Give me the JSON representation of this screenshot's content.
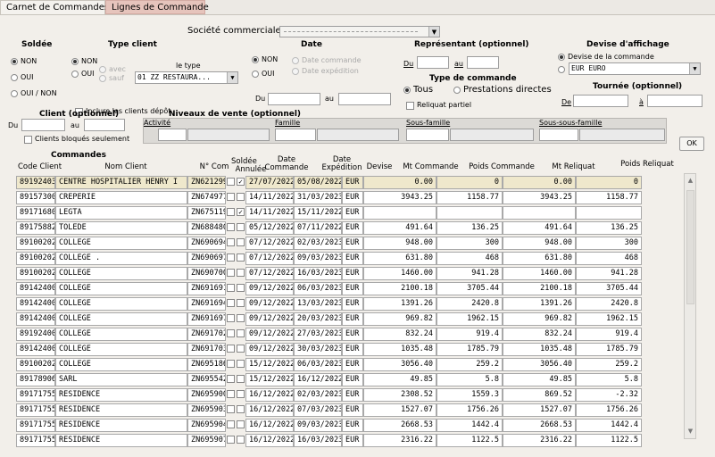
{
  "tabs": [
    {
      "label": "Carnet de Commandes",
      "active": true
    },
    {
      "label": "Lignes de Commande",
      "active": false
    }
  ],
  "filters": {
    "societe_label": "Société commerciale :",
    "societe_value": "",
    "soldee": {
      "title": "Soldée",
      "options": [
        "NON",
        "OUI",
        "OUI / NON"
      ],
      "selected": "NON"
    },
    "type_client": {
      "title": "Type client",
      "options": [
        "NON",
        "OUI"
      ],
      "selected": "NON",
      "sub_options": [
        "avec",
        "sauf"
      ],
      "le_type_label": "le type",
      "le_type_value": "01 ZZ RESTAURA...",
      "inclure_label": "Inclure les clients dépôt"
    },
    "date": {
      "title": "Date",
      "options": [
        "NON",
        "OUI"
      ],
      "selected": "NON",
      "sub_options": [
        "Date commande",
        "Date expédition"
      ],
      "du_label": "Du",
      "au_label": "au"
    },
    "representant": {
      "title": "Représentant (optionnel)",
      "du_label": "Du",
      "au_label": "au"
    },
    "type_commande": {
      "title": "Type de commande",
      "options": [
        "Tous",
        "Prestations directes"
      ],
      "selected": "Tous",
      "reliquat_label": "Reliquat partiel"
    },
    "devise": {
      "title": "Devise d'affichage",
      "options": [
        "Devise de la commande",
        "EUR  EURO"
      ],
      "selected": "Devise de la commande",
      "select_value": "EUR  EURO"
    },
    "tournee": {
      "title": "Tournée (optionnel)",
      "de_label": "De",
      "a_label": "à"
    },
    "client": {
      "title": "Client (optionnel)",
      "du_label": "Du",
      "au_label": "au",
      "bloques_label": "Clients bloqués seulement"
    },
    "niveaux": {
      "title": "Niveaux de vente (optionnel)",
      "labels": [
        "Activité",
        "Famille",
        "Sous-famille",
        "Sous-sous-famille"
      ]
    },
    "ok_label": "OK"
  },
  "commandes": {
    "title": "Commandes",
    "headers": {
      "code": "Code Client",
      "nom": "Nom Client",
      "ncom": "N° Com",
      "soldee": "Soldée",
      "annulee": "Annulée",
      "date_cmd": "Date\nCommande",
      "date_exp": "Date\nExpédition",
      "devise": "Devise",
      "mt_cmd": "Mt Commande",
      "poids_cmd": "Poids Commande",
      "mt_rel": "Mt Reliquat",
      "poids_rel": "Poids Reliquat"
    },
    "rows": [
      {
        "code": "89192403",
        "nom": "CENTRE HOSPITALIER HENRY I",
        "ncom": "ZN621299",
        "soldee": false,
        "annulee": true,
        "date_cmd": "27/07/2022",
        "date_exp": "05/08/2022",
        "devise": "EUR",
        "mt_cmd": "0.00",
        "poids_cmd": "0",
        "mt_rel": "0.00",
        "poids_rel": "0",
        "selected": true
      },
      {
        "code": "89157300",
        "nom": "CREPERIE",
        "ncom": "ZN674977",
        "soldee": false,
        "annulee": false,
        "date_cmd": "14/11/2022",
        "date_exp": "31/03/2023",
        "devise": "EUR",
        "mt_cmd": "3943.25",
        "poids_cmd": "1158.77",
        "mt_rel": "3943.25",
        "poids_rel": "1158.77"
      },
      {
        "code": "89171680",
        "nom": "LEGTA",
        "ncom": "ZN675119",
        "soldee": false,
        "annulee": true,
        "date_cmd": "14/11/2022",
        "date_exp": "15/11/2022",
        "devise": "EUR",
        "mt_cmd": "",
        "poids_cmd": "",
        "mt_rel": "",
        "poids_rel": ""
      },
      {
        "code": "89175882",
        "nom": "TOLEDE",
        "ncom": "ZN688480",
        "soldee": false,
        "annulee": false,
        "date_cmd": "05/12/2022",
        "date_exp": "07/11/2022",
        "devise": "EUR",
        "mt_cmd": "491.64",
        "poids_cmd": "136.25",
        "mt_rel": "491.64",
        "poids_rel": "136.25"
      },
      {
        "code": "89100202",
        "nom": "COLLEGE",
        "ncom": "ZN690694",
        "soldee": false,
        "annulee": false,
        "date_cmd": "07/12/2022",
        "date_exp": "02/03/2023",
        "devise": "EUR",
        "mt_cmd": "948.00",
        "poids_cmd": "300",
        "mt_rel": "948.00",
        "poids_rel": "300"
      },
      {
        "code": "89100202",
        "nom": "COLLEGE .",
        "ncom": "ZN690697",
        "soldee": false,
        "annulee": false,
        "date_cmd": "07/12/2022",
        "date_exp": "09/03/2023",
        "devise": "EUR",
        "mt_cmd": "631.80",
        "poids_cmd": "468",
        "mt_rel": "631.80",
        "poids_rel": "468"
      },
      {
        "code": "89100202",
        "nom": "COLLEGE",
        "ncom": "ZN690700",
        "soldee": false,
        "annulee": false,
        "date_cmd": "07/12/2022",
        "date_exp": "16/03/2023",
        "devise": "EUR",
        "mt_cmd": "1460.00",
        "poids_cmd": "941.28",
        "mt_rel": "1460.00",
        "poids_rel": "941.28"
      },
      {
        "code": "89142400",
        "nom": "COLLEGE",
        "ncom": "ZN691691",
        "soldee": false,
        "annulee": false,
        "date_cmd": "09/12/2022",
        "date_exp": "06/03/2023",
        "devise": "EUR",
        "mt_cmd": "2100.18",
        "poids_cmd": "3705.44",
        "mt_rel": "2100.18",
        "poids_rel": "3705.44"
      },
      {
        "code": "89142400",
        "nom": "COLLEGE",
        "ncom": "ZN691694",
        "soldee": false,
        "annulee": false,
        "date_cmd": "09/12/2022",
        "date_exp": "13/03/2023",
        "devise": "EUR",
        "mt_cmd": "1391.26",
        "poids_cmd": "2420.8",
        "mt_rel": "1391.26",
        "poids_rel": "2420.8"
      },
      {
        "code": "89142400",
        "nom": "COLLEGE",
        "ncom": "ZN691697",
        "soldee": false,
        "annulee": false,
        "date_cmd": "09/12/2022",
        "date_exp": "20/03/2023",
        "devise": "EUR",
        "mt_cmd": "969.82",
        "poids_cmd": "1962.15",
        "mt_rel": "969.82",
        "poids_rel": "1962.15"
      },
      {
        "code": "89192400",
        "nom": "COLLEGE",
        "ncom": "ZN691702",
        "soldee": false,
        "annulee": false,
        "date_cmd": "09/12/2022",
        "date_exp": "27/03/2023",
        "devise": "EUR",
        "mt_cmd": "832.24",
        "poids_cmd": "919.4",
        "mt_rel": "832.24",
        "poids_rel": "919.4"
      },
      {
        "code": "89142400",
        "nom": "COLLEGE",
        "ncom": "ZN691703",
        "soldee": false,
        "annulee": false,
        "date_cmd": "09/12/2022",
        "date_exp": "30/03/2023",
        "devise": "EUR",
        "mt_cmd": "1035.48",
        "poids_cmd": "1785.79",
        "mt_rel": "1035.48",
        "poids_rel": "1785.79"
      },
      {
        "code": "89100202",
        "nom": "COLLEGE",
        "ncom": "ZN695186",
        "soldee": false,
        "annulee": false,
        "date_cmd": "15/12/2022",
        "date_exp": "06/03/2023",
        "devise": "EUR",
        "mt_cmd": "3056.40",
        "poids_cmd": "259.2",
        "mt_rel": "3056.40",
        "poids_rel": "259.2"
      },
      {
        "code": "89178906",
        "nom": "SARL",
        "ncom": "ZN695542",
        "soldee": false,
        "annulee": false,
        "date_cmd": "15/12/2022",
        "date_exp": "16/12/2022",
        "devise": "EUR",
        "mt_cmd": "49.85",
        "poids_cmd": "5.8",
        "mt_rel": "49.85",
        "poids_rel": "5.8"
      },
      {
        "code": "89171755",
        "nom": "RESIDENCE",
        "ncom": "ZN695900",
        "soldee": false,
        "annulee": false,
        "date_cmd": "16/12/2022",
        "date_exp": "02/03/2023",
        "devise": "EUR",
        "mt_cmd": "2308.52",
        "poids_cmd": "1559.3",
        "mt_rel": "869.52",
        "poids_rel": "-2.32"
      },
      {
        "code": "89171755",
        "nom": "RESIDENCE",
        "ncom": "ZN695903",
        "soldee": false,
        "annulee": false,
        "date_cmd": "16/12/2022",
        "date_exp": "07/03/2023",
        "devise": "EUR",
        "mt_cmd": "1527.07",
        "poids_cmd": "1756.26",
        "mt_rel": "1527.07",
        "poids_rel": "1756.26"
      },
      {
        "code": "89171755",
        "nom": "RESIDENCE",
        "ncom": "ZN695904",
        "soldee": false,
        "annulee": false,
        "date_cmd": "16/12/2022",
        "date_exp": "09/03/2023",
        "devise": "EUR",
        "mt_cmd": "2668.53",
        "poids_cmd": "1442.4",
        "mt_rel": "2668.53",
        "poids_rel": "1442.4"
      },
      {
        "code": "89171755",
        "nom": "RESIDENCE",
        "ncom": "ZN695907",
        "soldee": false,
        "annulee": false,
        "date_cmd": "16/12/2022",
        "date_exp": "16/03/2023",
        "devise": "EUR",
        "mt_cmd": "2316.22",
        "poids_cmd": "1122.5",
        "mt_rel": "2316.22",
        "poids_rel": "1122.5"
      }
    ]
  }
}
